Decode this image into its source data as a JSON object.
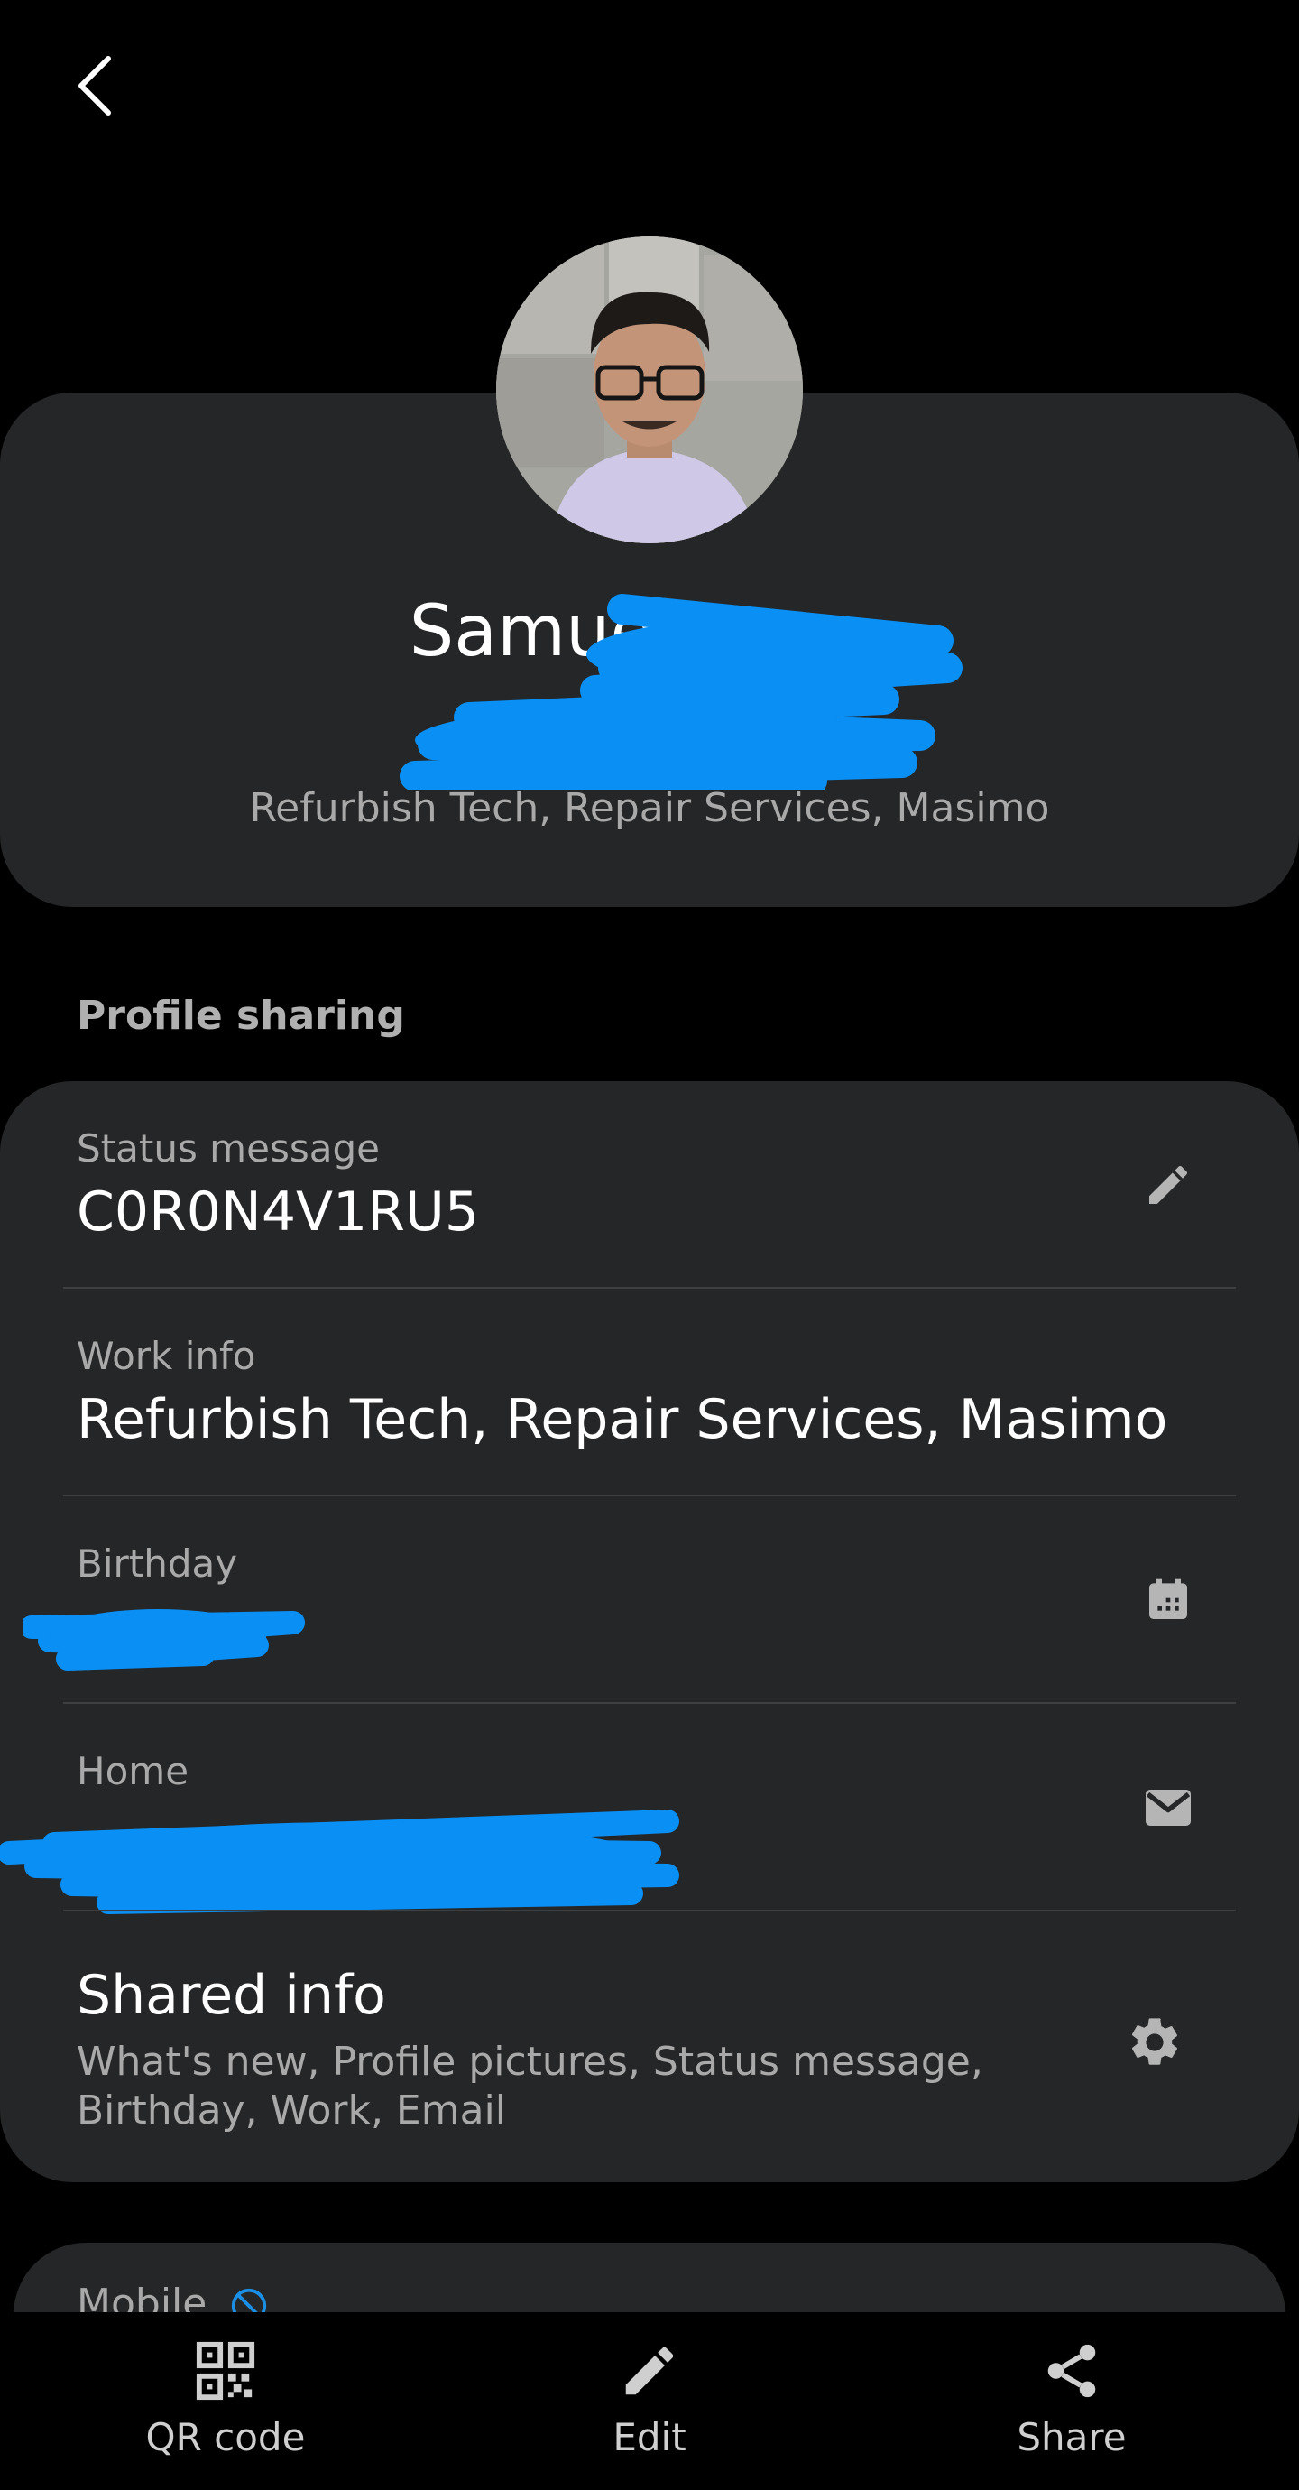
{
  "header": {
    "back_icon": "chevron-left-icon"
  },
  "profile": {
    "name": "Samuel",
    "subtitle": "Refurbish Tech, Repair Services, Masimo"
  },
  "profile_sharing": {
    "section_title": "Profile sharing",
    "status_message": {
      "label": "Status message",
      "value": "C0R0N4V1RU5",
      "icon": "pencil-icon"
    },
    "work_info": {
      "label": "Work info",
      "value": "Refurbish Tech, Repair Services, Masimo"
    },
    "birthday": {
      "label": "Birthday",
      "icon": "calendar-icon"
    },
    "home": {
      "label": "Home",
      "icon": "mail-icon"
    },
    "shared_info": {
      "title": "Shared info",
      "description": "What's new, Profile pictures, Status message, Birthday, Work, Email",
      "icon": "gear-icon"
    }
  },
  "mobile": {
    "label": "Mobile",
    "icon": "blocked-icon"
  },
  "bottom_nav": [
    {
      "label": "QR code",
      "icon": "qr-code-icon"
    },
    {
      "label": "Edit",
      "icon": "pencil-icon"
    },
    {
      "label": "Share",
      "icon": "share-icon"
    }
  ],
  "colors": {
    "background": "#000000",
    "card": "#252627",
    "redaction": "#0a8ff5"
  }
}
